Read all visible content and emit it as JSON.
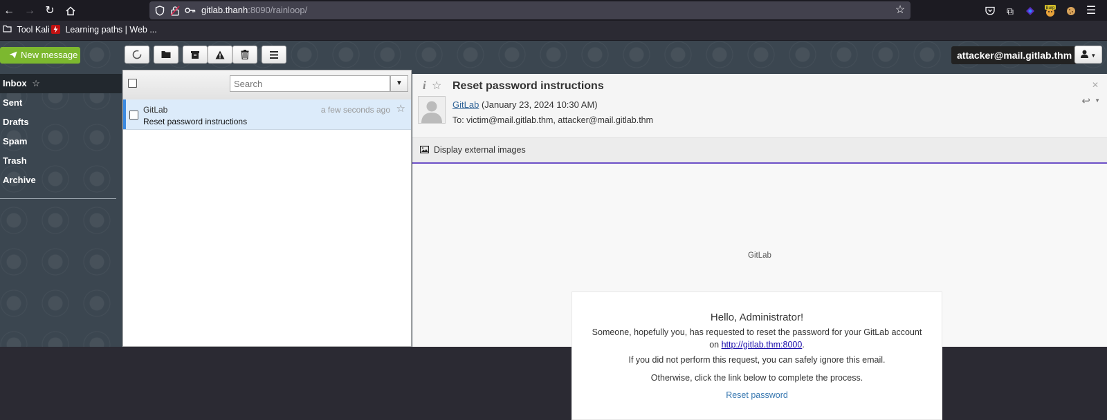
{
  "browser": {
    "url_host": "gitlab.thanh",
    "url_rest": ":8090/rainloop/",
    "ext_badge": "Burp",
    "bookmarks": [
      {
        "label": "Tool Kali"
      },
      {
        "label": "Learning paths | Web ..."
      }
    ]
  },
  "toolbar": {
    "new_message_label": "New message",
    "account": "attacker@mail.gitlab.thm"
  },
  "folders": [
    {
      "label": "Inbox"
    },
    {
      "label": "Sent"
    },
    {
      "label": "Drafts"
    },
    {
      "label": "Spam"
    },
    {
      "label": "Trash"
    },
    {
      "label": "Archive"
    }
  ],
  "message_list": {
    "search_placeholder": "Search",
    "messages": [
      {
        "from": "GitLab",
        "subject": "Reset password instructions",
        "time": "a few seconds ago"
      }
    ]
  },
  "message_view": {
    "subject": "Reset password instructions",
    "sender_name": "GitLab",
    "date": "(January 23, 2024 10:30 AM)",
    "to": "To: victim@mail.gitlab.thm, attacker@mail.gitlab.thm",
    "external_images_label": "Display external images",
    "body": {
      "brand": "GitLab",
      "greeting": "Hello, Administrator!",
      "line1": "Someone, hopefully you, has requested to reset the password for your GitLab account",
      "line2_prefix": "on ",
      "line2_link": "http://gitlab.thm:8000",
      "line2_suffix": ".",
      "line3": "If you did not perform this request, you can safely ignore this email.",
      "line4": "Otherwise, click the link below to complete the process.",
      "reset_link": "Reset password"
    }
  },
  "colors": {
    "new_message_bg": "#7cb82f",
    "selected_row_bg": "#dcebfa",
    "external_bar_underline": "#6c4fc7",
    "link": "#3777b0"
  }
}
